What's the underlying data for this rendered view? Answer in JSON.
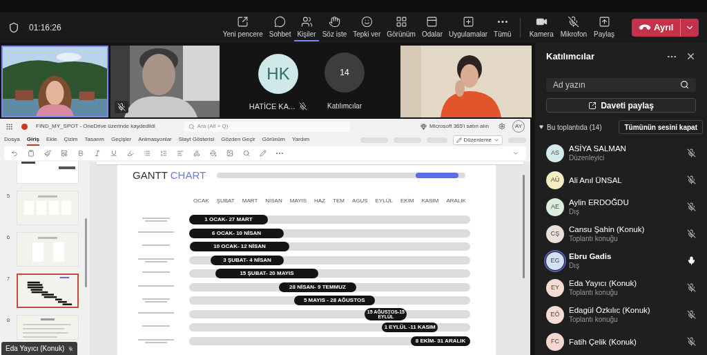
{
  "meeting_bar": {
    "timer": "01:16:26",
    "actions": [
      {
        "label": "Yeni pencere",
        "selected": false
      },
      {
        "label": "Sohbet",
        "selected": false
      },
      {
        "label": "Kişiler",
        "selected": true
      },
      {
        "label": "Söz iste",
        "selected": false
      },
      {
        "label": "Tepki ver",
        "selected": false
      },
      {
        "label": "Görünüm",
        "selected": false
      },
      {
        "label": "Odalar",
        "selected": false
      },
      {
        "label": "Uygulamalar",
        "selected": false
      },
      {
        "label": "Tümü",
        "selected": false
      }
    ],
    "devices": [
      {
        "label": "Kamera",
        "off": false
      },
      {
        "label": "Mikrofon",
        "off": true
      }
    ],
    "share_label": "Paylaş",
    "leave_label": "Ayrıl"
  },
  "video_tiles": [
    {
      "kind": "video",
      "selected": true,
      "muted": false
    },
    {
      "kind": "video",
      "selected": false,
      "muted": true
    },
    {
      "kind": "avatar",
      "initials": "HK",
      "name": "HATİCE KA...",
      "muted": true
    },
    {
      "kind": "overflow",
      "count": "14",
      "label": "Katılımcılar"
    },
    {
      "kind": "video",
      "selected": false,
      "muted": false
    }
  ],
  "presentation": {
    "file_title": "FIND_MY_SPOT - OneDrive üzerinde kaydedildi",
    "search_placeholder": "Ara (Alt + Q)",
    "buy_label": "Microsoft 365'i satın alın",
    "user_initials": "AY",
    "tabs": [
      {
        "label": "Dosya",
        "selected": false
      },
      {
        "label": "Giriş",
        "selected": true
      },
      {
        "label": "Ekle",
        "selected": false
      },
      {
        "label": "Çizim",
        "selected": false
      },
      {
        "label": "Tasarım",
        "selected": false
      },
      {
        "label": "Geçişler",
        "selected": false
      },
      {
        "label": "Animasyonlar",
        "selected": false
      },
      {
        "label": "Slayt Gösterisi",
        "selected": false
      },
      {
        "label": "Gözden Geçir",
        "selected": false
      },
      {
        "label": "Görünüm",
        "selected": false
      },
      {
        "label": "Yardım",
        "selected": false
      }
    ],
    "mode_label": "Düzenleme",
    "thumbnails": [
      {
        "selected": false
      },
      {
        "number": "5",
        "selected": false
      },
      {
        "number": "6",
        "selected": false
      },
      {
        "number": "7",
        "selected": true
      },
      {
        "number": "8",
        "selected": false
      }
    ],
    "presenter_name": "Eda Yayıcı (Konuk)",
    "slide": {
      "title_1": "GANTT",
      "title_2": "CHART",
      "months": [
        "OCAK",
        "ŞUBAT",
        "MART",
        "NİSAN",
        "MAYIS",
        "HAZ",
        "TEM",
        "AGUS",
        "EYLÜL",
        "EKİM",
        "KASIM",
        "ARALIK"
      ],
      "tasks": [
        {
          "dates": "1 OCAK- 27 MART"
        },
        {
          "dates": "6 OCAK- 10 NİSAN"
        },
        {
          "dates": "10 OCAK- 12 NİSAN"
        },
        {
          "dates": "3 ŞUBAT- 4 NİSAN"
        },
        {
          "dates": "15 ŞUBAT- 20 MAYIS"
        },
        {
          "dates": "28 NİSAN- 9 TEMMUZ"
        },
        {
          "dates": "5 MAYIS - 28 AĞUSTOS"
        },
        {
          "dates": "15 AĞUSTOS-15 EYLÜL"
        },
        {
          "dates": "1 EYLÜL -11 KASIM"
        },
        {
          "dates": "8 EKİM- 31 ARALIK"
        }
      ]
    }
  },
  "participants_panel": {
    "title": "Katılımcılar",
    "search_placeholder": "Ad yazın",
    "invite_label": "Daveti paylaş",
    "section_label": "Bu toplantıda (14)",
    "section_expanded": true,
    "mute_all_label": "Tümünün sesini kapat",
    "people": [
      {
        "initials": "AS",
        "name": "ASİYA SALMAN",
        "role": "Düzenleyici",
        "color": "#d4ebeb",
        "muted": true,
        "speaking": false
      },
      {
        "initials": "AÜ",
        "name": "Ali Anıl ÜNSAL",
        "color": "#f5ecbf",
        "muted": true,
        "speaking": false
      },
      {
        "initials": "AE",
        "name": "Aylin ERDOĞDU",
        "role": "Dış",
        "color": "#dbeedb",
        "muted": true,
        "speaking": false
      },
      {
        "initials": "CŞ",
        "name": "Cansu Şahin (Konuk)",
        "role": "Toplantı konuğu",
        "color": "#ece0da",
        "muted": true,
        "speaking": false
      },
      {
        "initials": "EG",
        "name": "Ebru Gadis",
        "role": "Dış",
        "color": "#d3e2f2",
        "muted": false,
        "speaking": true
      },
      {
        "initials": "EY",
        "name": "Eda Yayıcı (Konuk)",
        "role": "Toplantı konuğu",
        "color": "#f6dcd2",
        "muted": true,
        "speaking": false
      },
      {
        "initials": "EÖ",
        "name": "Edagül Özkılıc (Konuk)",
        "role": "Toplantı konuğu",
        "color": "#f7dcd5",
        "muted": true,
        "speaking": false
      },
      {
        "initials": "FC",
        "name": "Fatih Çelik (Konuk)",
        "color": "#f4d7d1",
        "muted": true,
        "speaking": false
      }
    ]
  }
}
